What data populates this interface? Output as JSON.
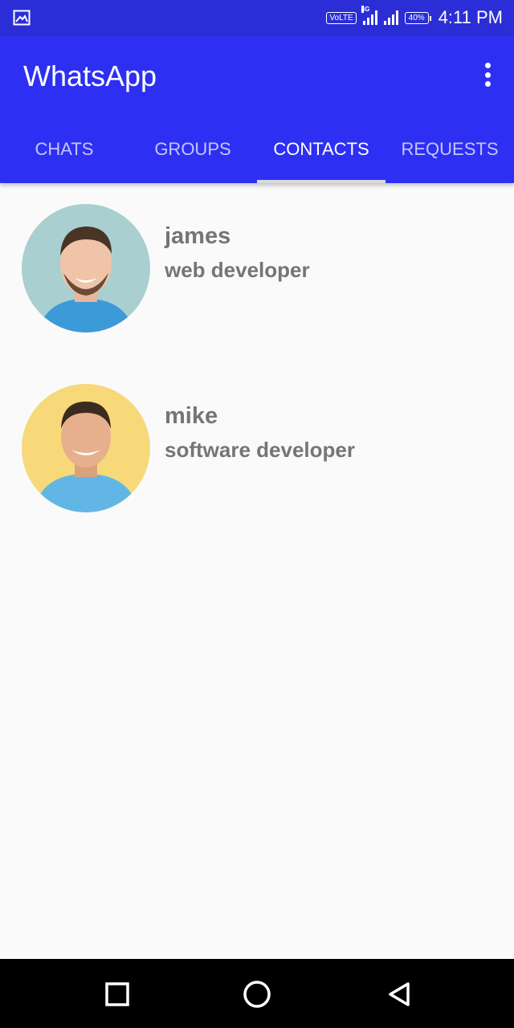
{
  "status_bar": {
    "volte": "VoLTE",
    "network": "4G",
    "battery": "40%",
    "time": "4:11 PM"
  },
  "app_bar": {
    "title": "WhatsApp"
  },
  "tabs": [
    {
      "label": "CHATS",
      "active": false
    },
    {
      "label": "GROUPS",
      "active": false
    },
    {
      "label": "CONTACTS",
      "active": true
    },
    {
      "label": "REQUESTS",
      "active": false
    }
  ],
  "contacts": [
    {
      "name": "james",
      "status": "web developer",
      "avatar_bg": "#a9cfd0",
      "shirt": "#3d9ad8"
    },
    {
      "name": "mike",
      "status": "software developer",
      "avatar_bg": "#f7d97a",
      "shirt": "#62b6e6"
    }
  ],
  "colors": {
    "status_bar": "#2b2ed6",
    "app_bar": "#2d2ff2",
    "text_gray": "#757575"
  }
}
